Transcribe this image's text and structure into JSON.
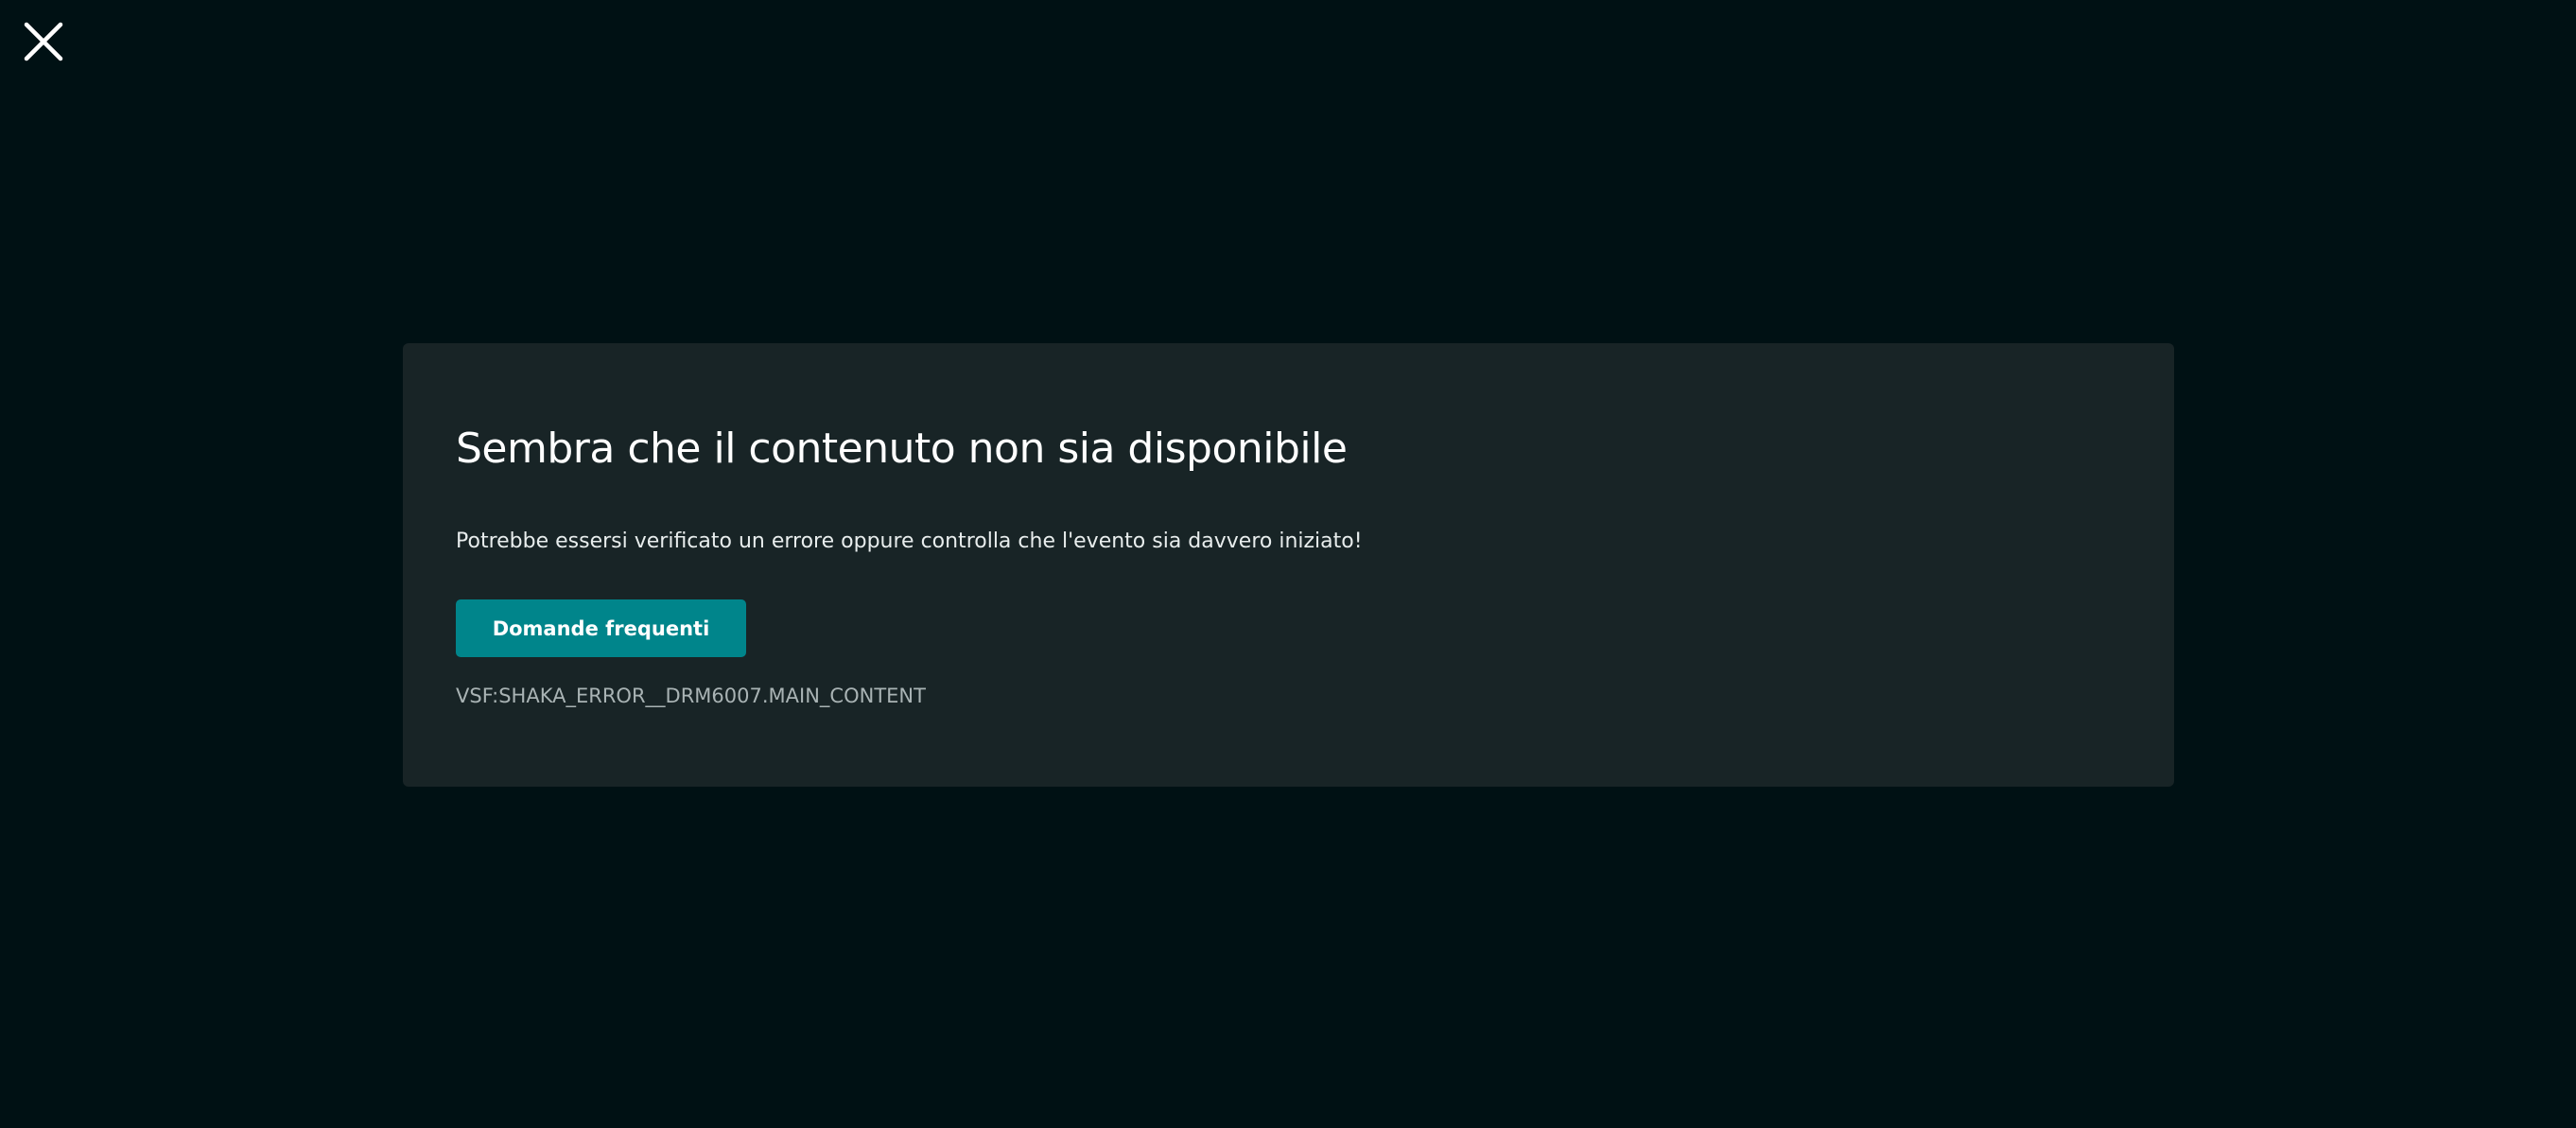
{
  "close": {
    "icon": "close-icon"
  },
  "dialog": {
    "title": "Sembra che il contenuto non sia disponibile",
    "message": "Potrebbe essersi verificato un errore oppure controlla che l'evento sia davvero iniziato!",
    "faq_button_label": "Domande frequenti",
    "error_code": "VSF:SHAKA_ERROR__DRM6007.MAIN_CONTENT"
  },
  "colors": {
    "background": "#001114",
    "dialog_background": "#182426",
    "accent": "#00858b",
    "title_text": "#ffffff",
    "secondary_text": "#a9b3b4"
  }
}
